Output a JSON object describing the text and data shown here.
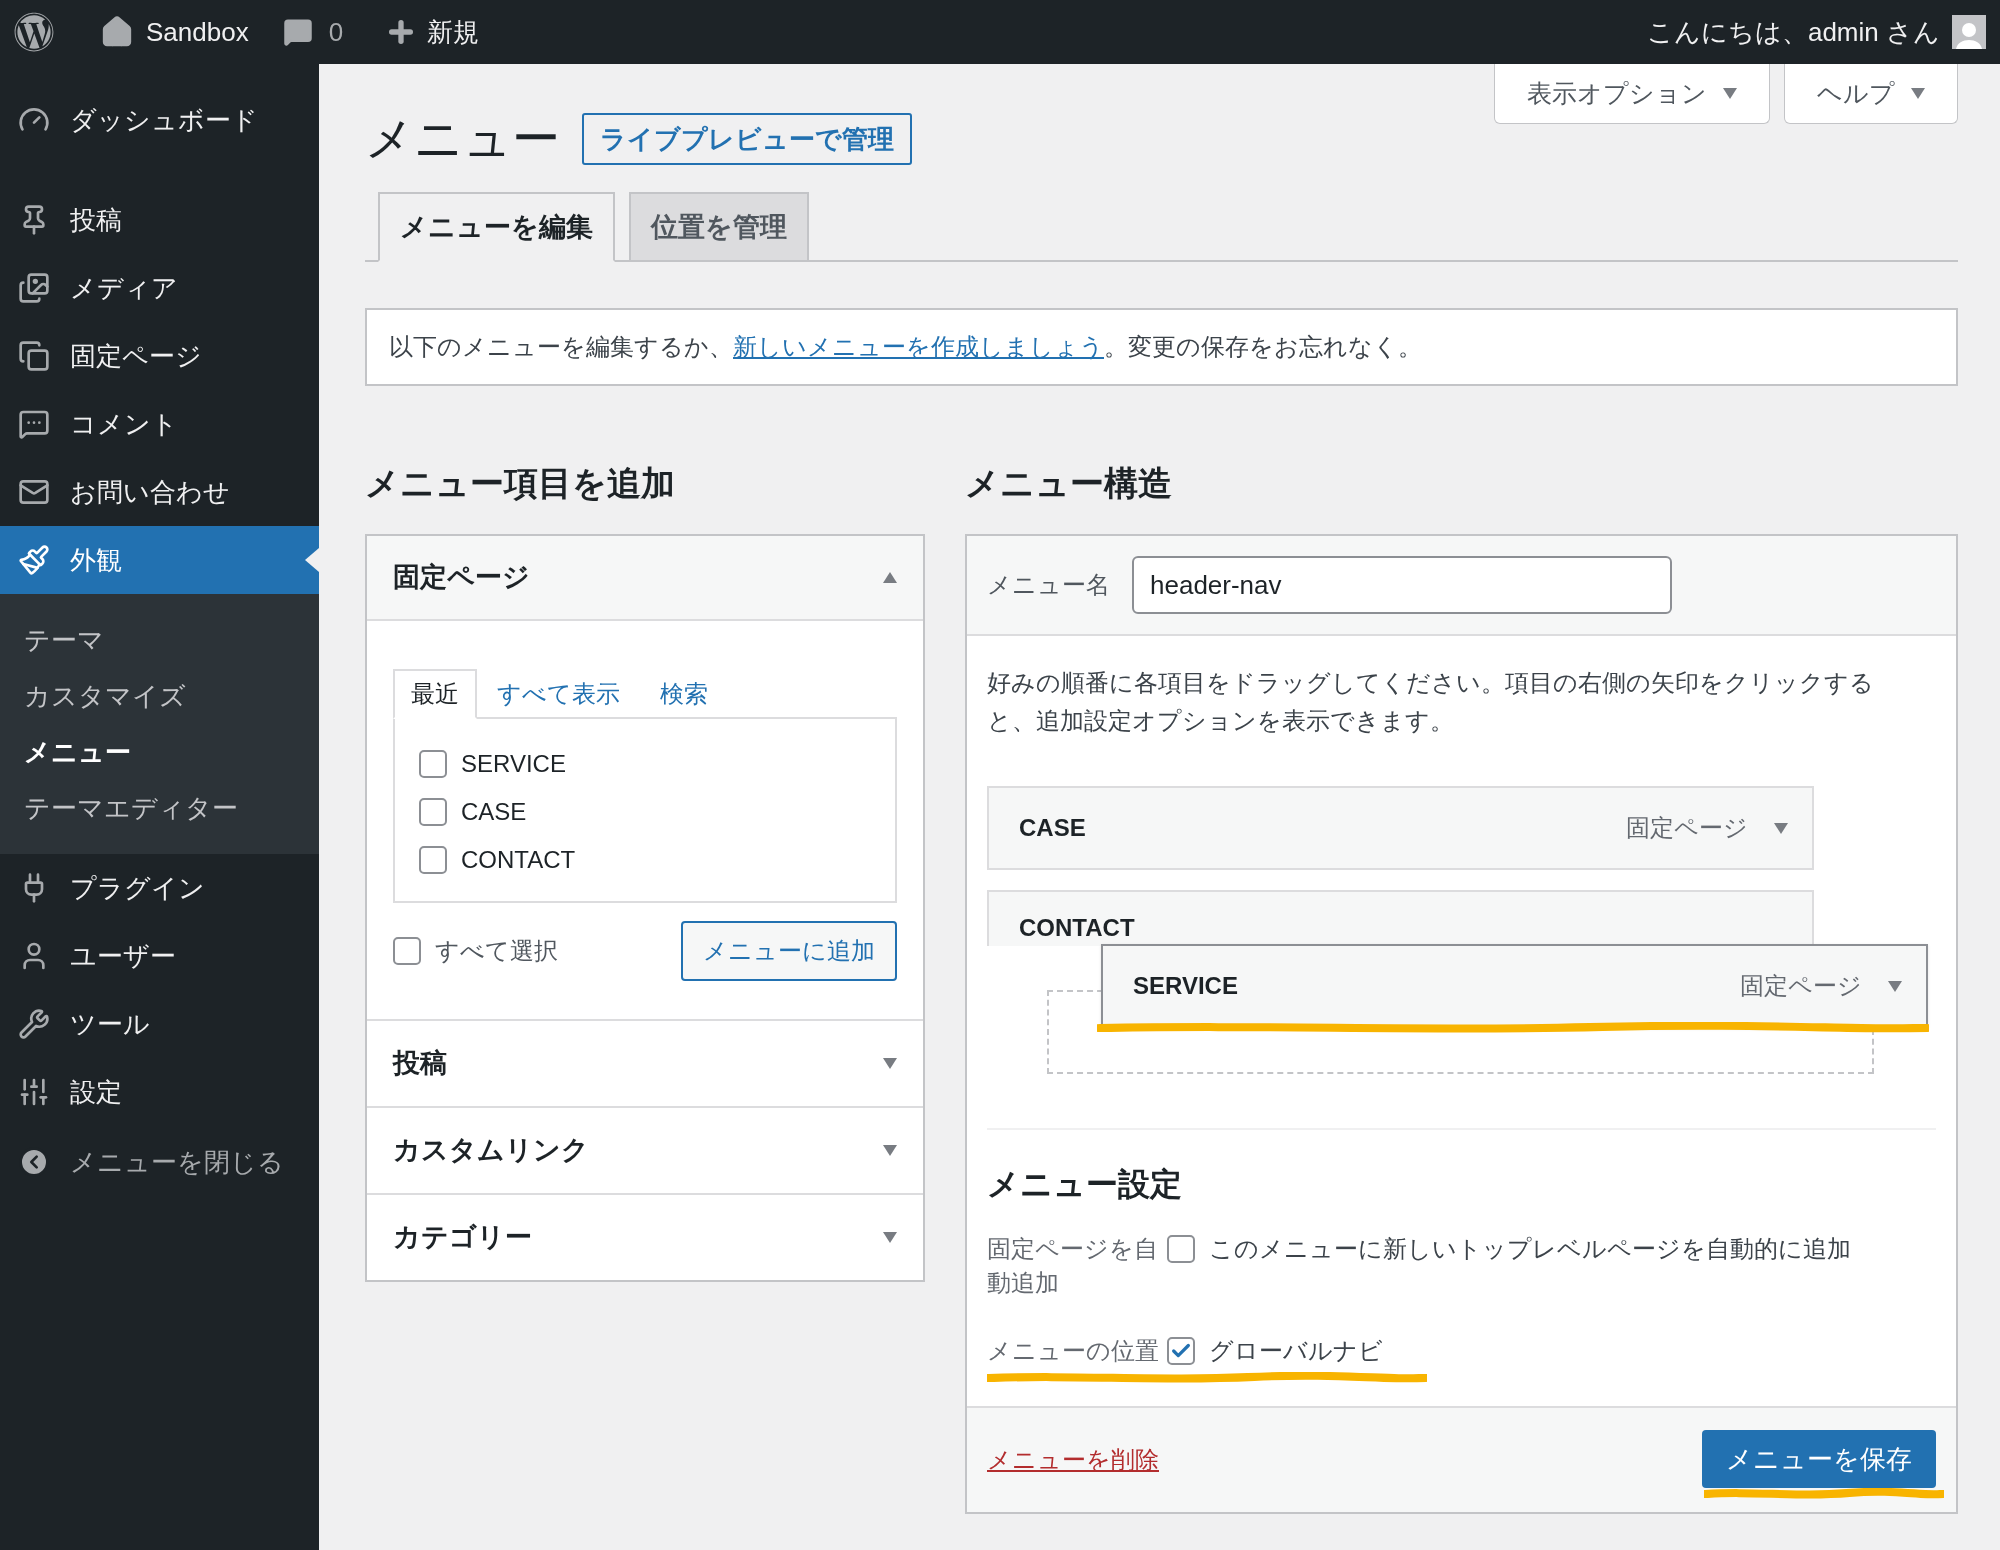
{
  "admin_bar": {
    "site_name": "Sandbox",
    "comments_count": "0",
    "new_label": "新規",
    "greeting": "こんにちは、admin さん"
  },
  "sidebar": {
    "items": [
      {
        "label": "ダッシュボード",
        "selected": false
      },
      {
        "label": "投稿",
        "selected": false
      },
      {
        "label": "メディア",
        "selected": false
      },
      {
        "label": "固定ページ",
        "selected": false
      },
      {
        "label": "コメント",
        "selected": false
      },
      {
        "label": "お問い合わせ",
        "selected": false
      },
      {
        "label": "外観",
        "selected": true,
        "children": [
          {
            "label": "テーマ",
            "selected": false
          },
          {
            "label": "カスタマイズ",
            "selected": false
          },
          {
            "label": "メニュー",
            "selected": true
          },
          {
            "label": "テーマエディター",
            "selected": false
          }
        ]
      },
      {
        "label": "プラグイン",
        "selected": false
      },
      {
        "label": "ユーザー",
        "selected": false
      },
      {
        "label": "ツール",
        "selected": false
      },
      {
        "label": "設定",
        "selected": false
      }
    ],
    "collapse_label": "メニューを閉じる"
  },
  "screen_tabs": [
    {
      "label": "表示オプション"
    },
    {
      "label": "ヘルプ"
    }
  ],
  "page_title": "メニュー",
  "live_preview_button": "ライブプレビューで管理",
  "tabs": [
    {
      "label": "メニューを編集",
      "selected": true
    },
    {
      "label": "位置を管理",
      "selected": false
    }
  ],
  "notice": {
    "before": "以下のメニューを編集するか、",
    "link": "新しいメニューを作成しましょう",
    "after": "。変更の保存をお忘れなく。"
  },
  "add_items": {
    "title": "メニュー項目を追加",
    "panels": [
      {
        "title": "固定ページ",
        "expanded": true,
        "tabs": [
          {
            "label": "最近",
            "selected": true
          },
          {
            "label": "すべて表示",
            "selected": false
          },
          {
            "label": "検索",
            "selected": false
          }
        ],
        "items": [
          {
            "label": "SERVICE",
            "checked": false
          },
          {
            "label": "CASE",
            "checked": false
          },
          {
            "label": "CONTACT",
            "checked": false
          }
        ],
        "select_all": {
          "label": "すべて選択",
          "checked": false
        },
        "add_button": "メニューに追加"
      },
      {
        "title": "投稿",
        "expanded": false
      },
      {
        "title": "カスタムリンク",
        "expanded": false
      },
      {
        "title": "カテゴリー",
        "expanded": false
      }
    ]
  },
  "structure": {
    "title": "メニュー構造",
    "name_label": "メニュー名",
    "name_value": "header-nav",
    "instructions": "好みの順番に各項目をドラッグしてください。項目の右側の矢印をクリックすると、追加設定オプションを表示できます。",
    "items": [
      {
        "title": "CASE",
        "type": "固定ページ",
        "dragging": false,
        "highlighted": false
      },
      {
        "title": "CONTACT",
        "dragging": false,
        "highlighted": false
      },
      {
        "title": "SERVICE",
        "type": "固定ページ",
        "dragging": true,
        "highlighted": true
      }
    ],
    "settings": {
      "title": "メニュー設定",
      "rows": [
        {
          "label": "固定ページを自動追加",
          "checked": false,
          "option": "このメニューに新しいトップレベルページを自動的に追加",
          "highlighted": false
        },
        {
          "label": "メニューの位置",
          "checked": true,
          "option": "グローバルナビ",
          "highlighted": true
        }
      ]
    },
    "delete_link": "メニューを削除",
    "save_button": {
      "label": "メニューを保存",
      "highlighted": true
    }
  }
}
